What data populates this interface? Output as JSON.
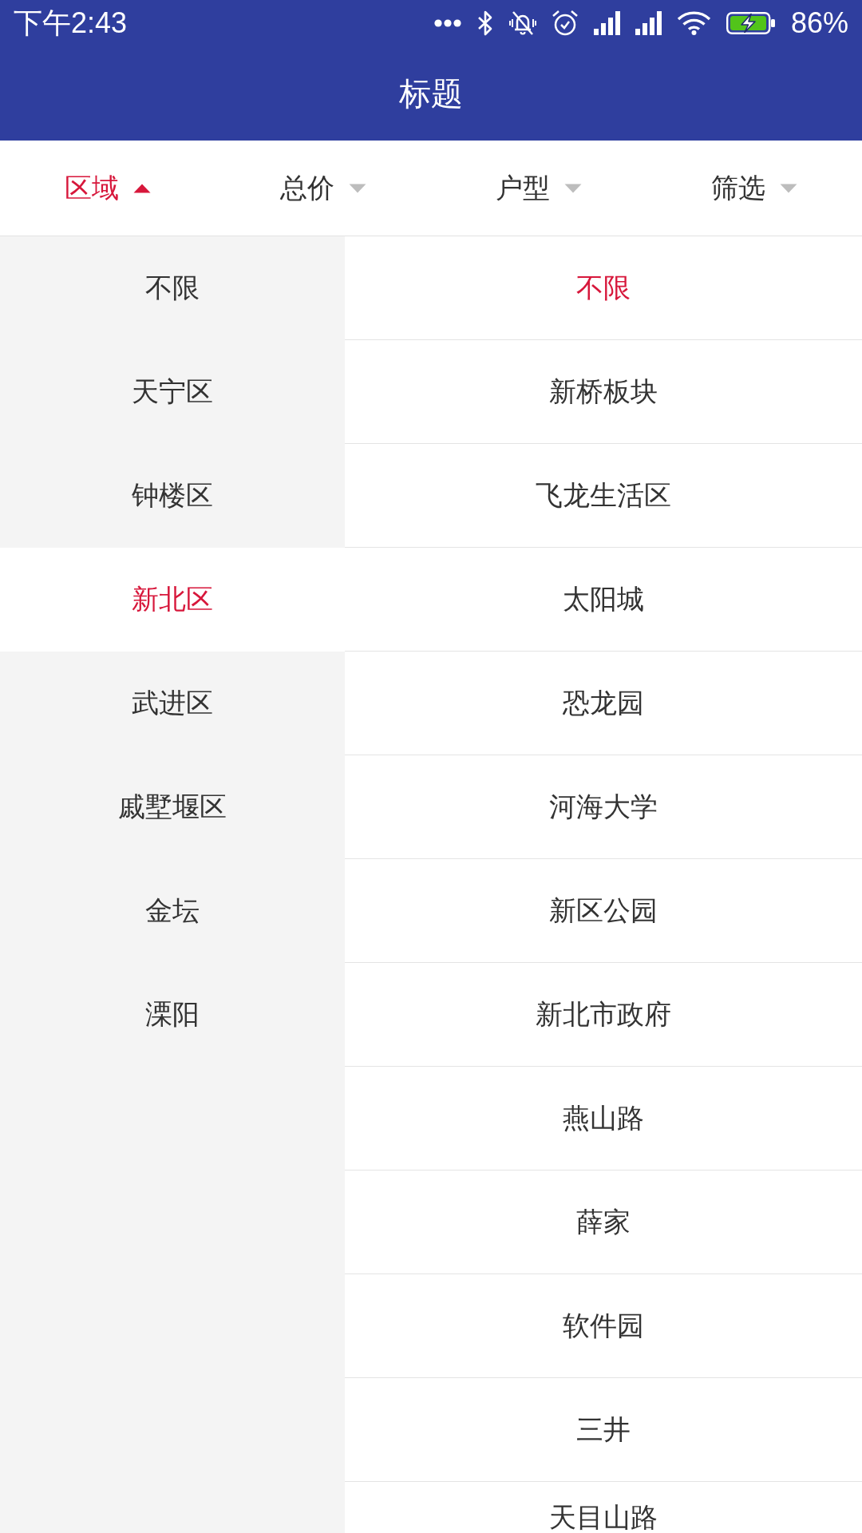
{
  "status_bar": {
    "time": "下午2:43",
    "battery": "86%"
  },
  "app_bar": {
    "title": "标题"
  },
  "filter_tabs": [
    {
      "label": "区域",
      "selected": true
    },
    {
      "label": "总价",
      "selected": false
    },
    {
      "label": "户型",
      "selected": false
    },
    {
      "label": "筛选",
      "selected": false
    }
  ],
  "district_list": [
    {
      "label": "不限",
      "selected": false
    },
    {
      "label": "天宁区",
      "selected": false
    },
    {
      "label": "钟楼区",
      "selected": false
    },
    {
      "label": "新北区",
      "selected": true
    },
    {
      "label": "武进区",
      "selected": false
    },
    {
      "label": "戚墅堰区",
      "selected": false
    },
    {
      "label": "金坛",
      "selected": false
    },
    {
      "label": "溧阳",
      "selected": false
    }
  ],
  "area_list": [
    {
      "label": "不限",
      "selected": true
    },
    {
      "label": "新桥板块",
      "selected": false
    },
    {
      "label": "飞龙生活区",
      "selected": false
    },
    {
      "label": "太阳城",
      "selected": false
    },
    {
      "label": "恐龙园",
      "selected": false
    },
    {
      "label": "河海大学",
      "selected": false
    },
    {
      "label": "新区公园",
      "selected": false
    },
    {
      "label": "新北市政府",
      "selected": false
    },
    {
      "label": "燕山路",
      "selected": false
    },
    {
      "label": "薛家",
      "selected": false
    },
    {
      "label": "软件园",
      "selected": false
    },
    {
      "label": "三井",
      "selected": false
    },
    {
      "label": "天目山路",
      "selected": false
    }
  ]
}
